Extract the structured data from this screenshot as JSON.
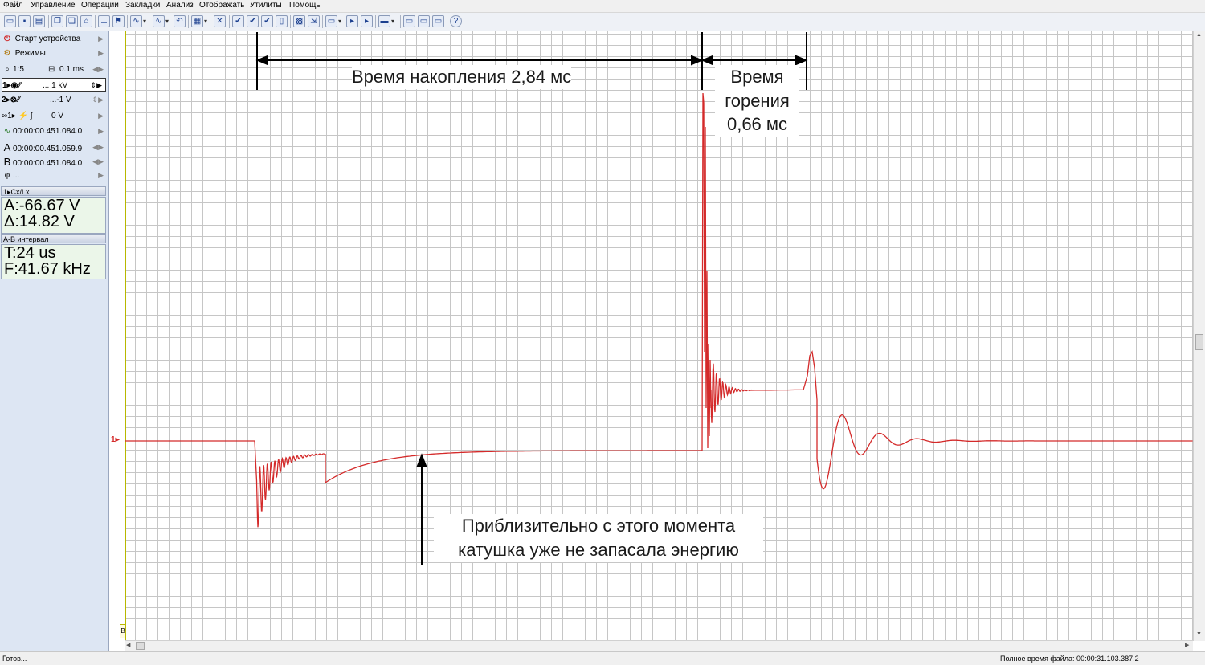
{
  "menu": [
    "Файл",
    "Управление",
    "Операции",
    "Закладки",
    "Анализ",
    "Отображать",
    "Утилиты",
    "Помощь"
  ],
  "left_panel": {
    "start_label": "Старт устройства",
    "modes_label": "Режимы",
    "zoom": "1:5",
    "timebase": "0.1 ms",
    "ch1_scale": "... 1 kV",
    "ch2_scale": "...-1 V",
    "trigger_level": "0 V",
    "trigger_time": "00:00:00.451.084.0",
    "cursor_a_time": "00:00:00.451.059.9",
    "cursor_b_time": "00:00:00.451.084.0",
    "phi_label": "...",
    "cx_header": "Cx/Lx",
    "cx_a": "A:-66.67 V",
    "cx_delta": "Δ:14.82 V",
    "ab_header": "A-B интервал",
    "ab_t": "T:24 us",
    "ab_f": "F:41.67 kHz"
  },
  "plot": {
    "channel_marker": "1",
    "trace_color": "#d42a2a",
    "cursor_color": "#b8b800"
  },
  "annotations": {
    "charge_time": "Время накопления 2,84 мс",
    "burn_title_1": "Время",
    "burn_title_2": "горения",
    "burn_value": "0,66 мс",
    "note_line1": "Приблизительно с этого момента",
    "note_line2": "катушка уже не запасала энергию"
  },
  "status": {
    "ready": "Готов...",
    "file_time": "Полное время файла: 00:00:31.103.387.2"
  },
  "icons": [
    "power-icon",
    "modes-icon",
    "zoom-icon",
    "timebase-icon",
    "channel1-icon",
    "channel2-icon",
    "trigger-icon",
    "cursor-a-icon",
    "cursor-b-icon",
    "phi-icon"
  ]
}
